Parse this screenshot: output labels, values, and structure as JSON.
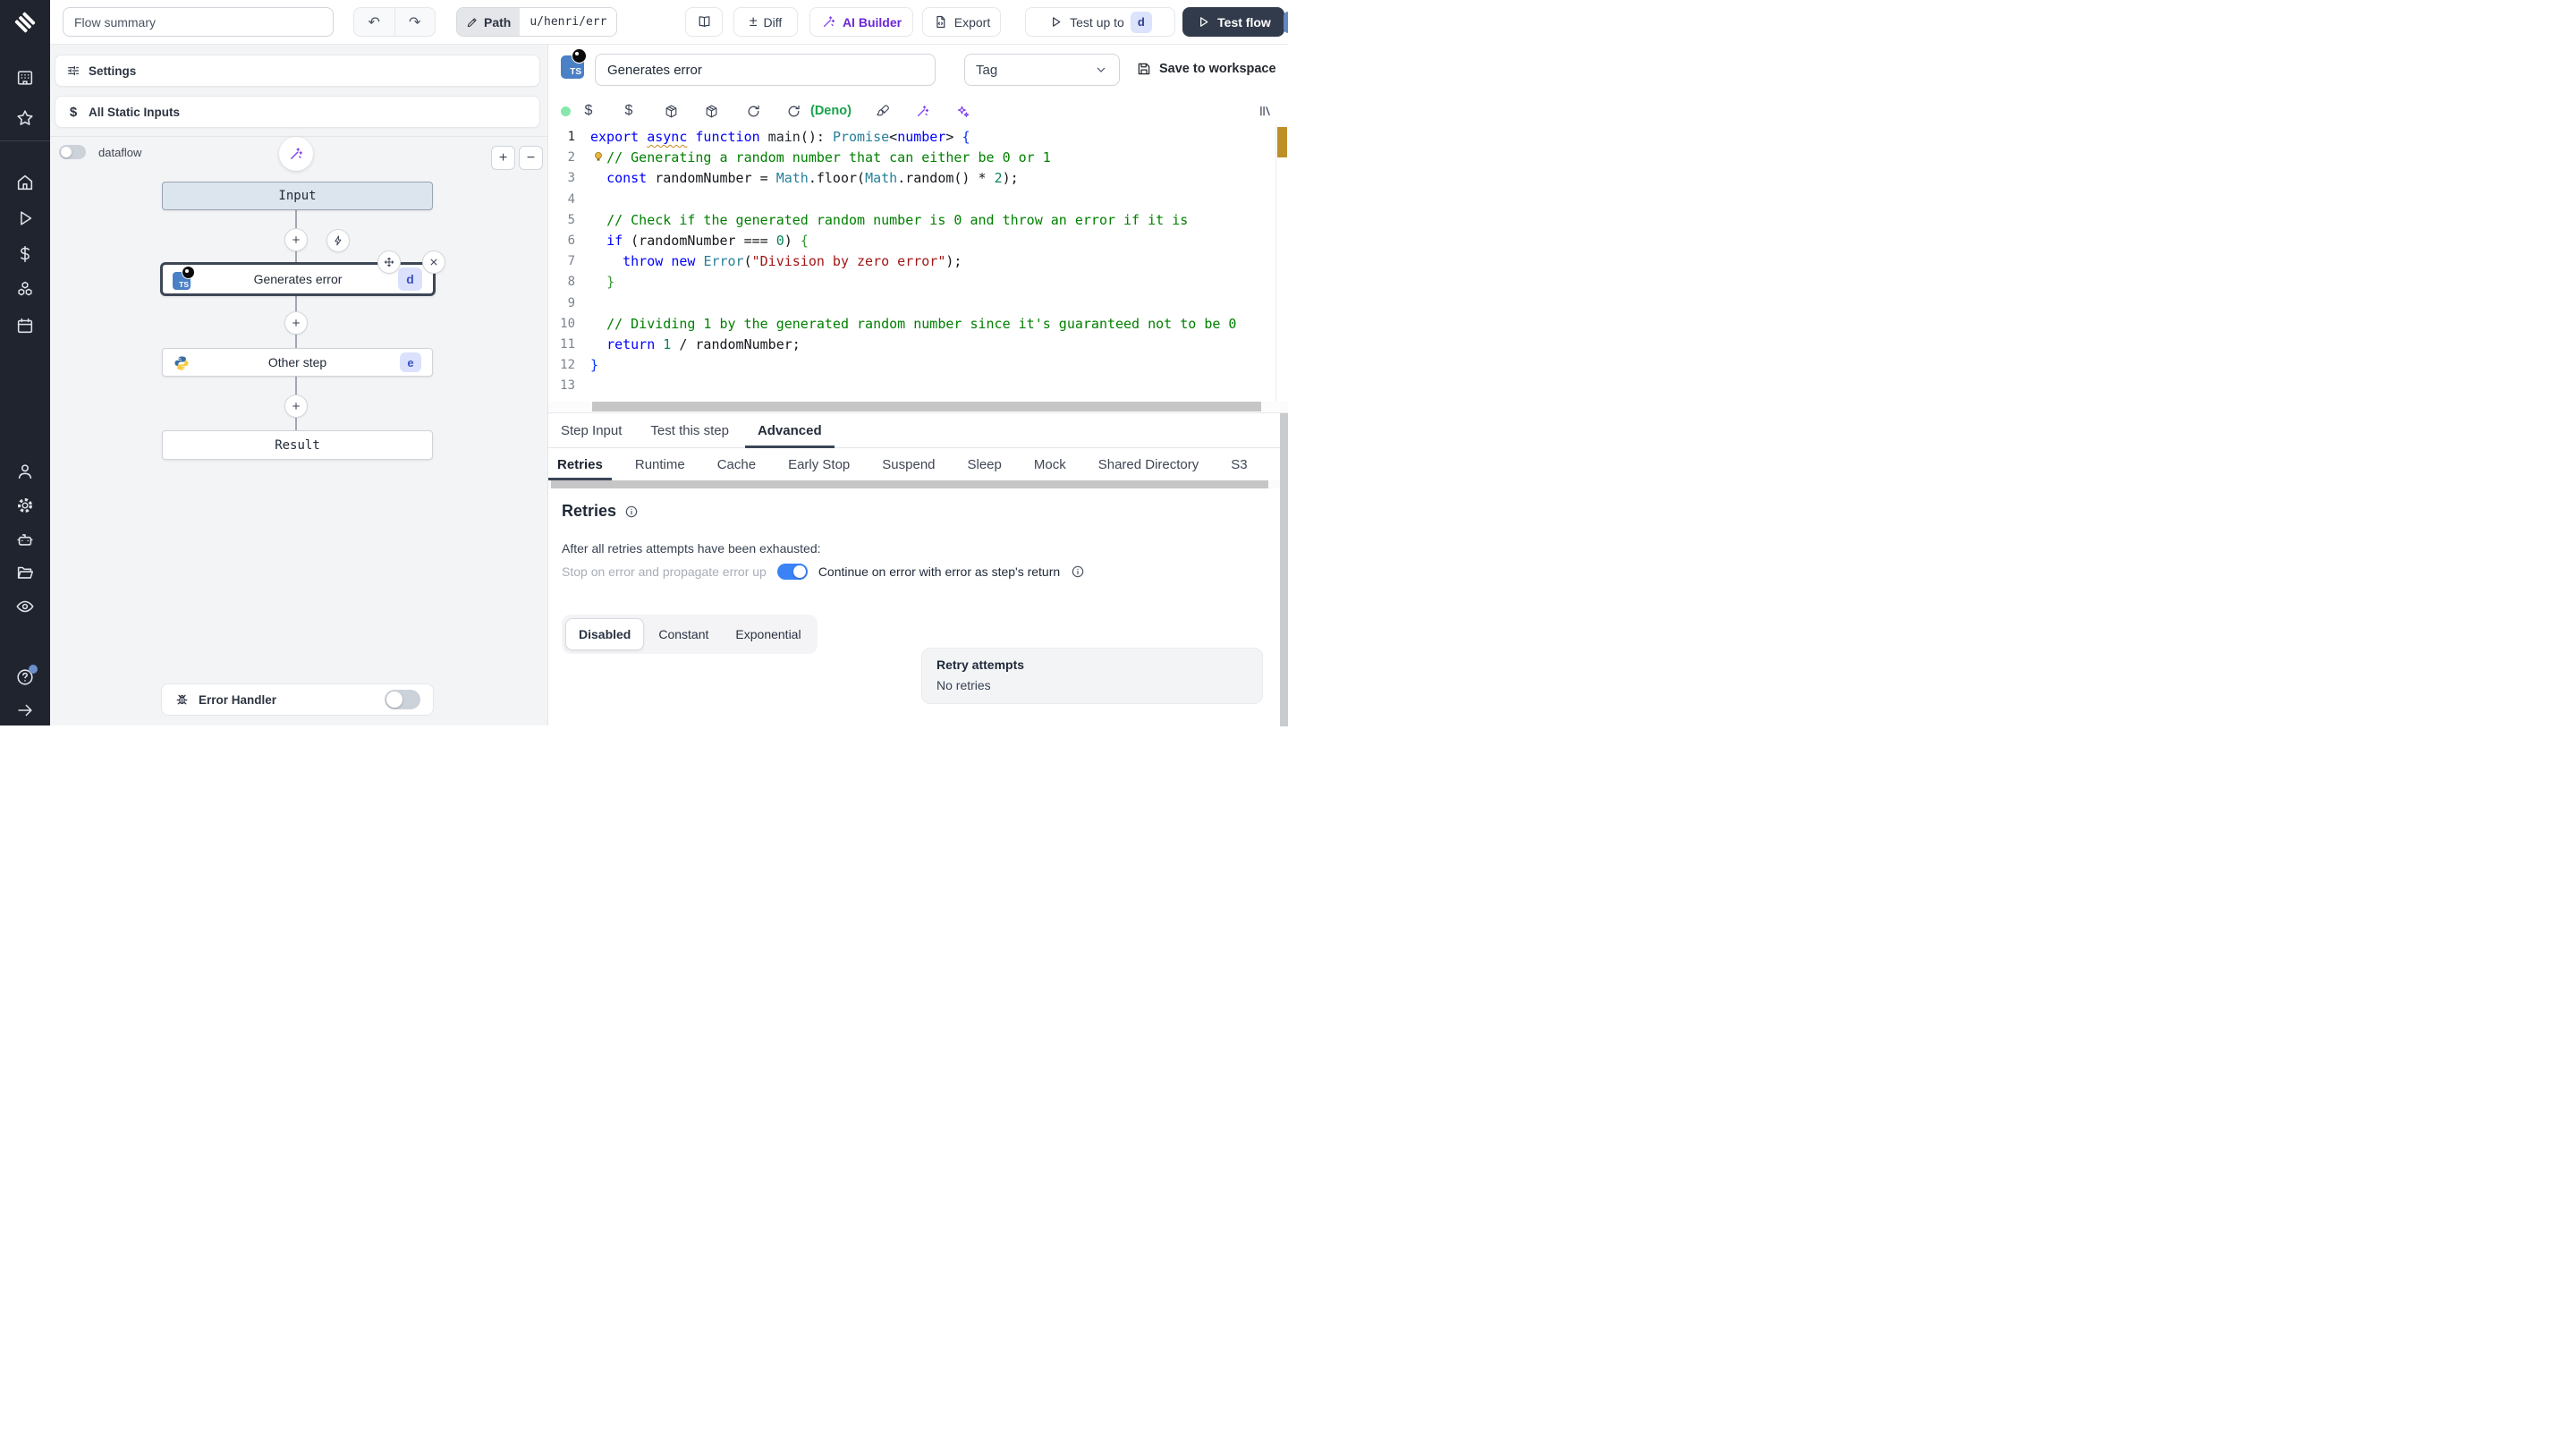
{
  "topbar": {
    "flow_summary_placeholder": "Flow summary",
    "undo": "↶",
    "redo": "↷",
    "path_label": "Path",
    "path_value": "u/henri/err",
    "diff_label": "Diff",
    "diff_icon": "±",
    "ai_builder_label": "AI Builder",
    "export_label": "Export",
    "test_up_to_label": "Test up to",
    "test_up_to_badge": "d",
    "test_flow_label": "Test flow"
  },
  "flow_panel": {
    "settings_label": "Settings",
    "static_inputs_icon": "$",
    "static_inputs_label": "All Static Inputs",
    "dataflow_label": "dataflow",
    "zoom_in_label": "+",
    "zoom_out_label": "−",
    "input_node_label": "Input",
    "step_node": {
      "label": "Generates error",
      "lang": "TS",
      "badge": "d"
    },
    "other_node": {
      "label": "Other step",
      "badge": "e"
    },
    "result_node_label": "Result",
    "error_handler_label": "Error Handler"
  },
  "editor": {
    "lang_badge": "TS",
    "step_name_value": "Generates error",
    "tag_placeholder": "Tag",
    "save_label": "Save to workspace",
    "dollar_icon": "$",
    "lang_label": "(Deno)",
    "lines": [
      {
        "n": 1,
        "seg": [
          [
            "kw",
            "export "
          ],
          [
            "kwu",
            "async"
          ],
          [
            "kw",
            " function"
          ],
          [
            "fn",
            " main"
          ],
          [
            "pl",
            "(): "
          ],
          [
            "ty",
            "Promise"
          ],
          [
            "pl",
            "<"
          ],
          [
            "kw",
            "number"
          ],
          [
            "pl",
            "> "
          ],
          [
            "brb",
            "{"
          ]
        ]
      },
      {
        "n": 2,
        "seg": [
          [
            "pl",
            "  "
          ],
          [
            "com",
            "// Generating a random number that can either be 0 or 1"
          ]
        ]
      },
      {
        "n": 3,
        "seg": [
          [
            "pl",
            "  "
          ],
          [
            "kw",
            "const"
          ],
          [
            "pl",
            " randomNumber = "
          ],
          [
            "ty",
            "Math"
          ],
          [
            "pl",
            ".floor("
          ],
          [
            "ty",
            "Math"
          ],
          [
            "pl",
            ".random() * "
          ],
          [
            "num",
            "2"
          ],
          [
            "pl",
            ");"
          ]
        ]
      },
      {
        "n": 4,
        "seg": []
      },
      {
        "n": 5,
        "seg": [
          [
            "pl",
            "  "
          ],
          [
            "com",
            "// Check if the generated random number is 0 and throw an error if it is"
          ]
        ]
      },
      {
        "n": 6,
        "seg": [
          [
            "pl",
            "  "
          ],
          [
            "kw",
            "if"
          ],
          [
            "pl",
            " (randomNumber === "
          ],
          [
            "num",
            "0"
          ],
          [
            "pl",
            ") "
          ],
          [
            "brg",
            "{"
          ]
        ]
      },
      {
        "n": 7,
        "seg": [
          [
            "pl",
            "    "
          ],
          [
            "kw",
            "throw"
          ],
          [
            "pl",
            " "
          ],
          [
            "kw",
            "new"
          ],
          [
            "pl",
            " "
          ],
          [
            "ty",
            "Error"
          ],
          [
            "pl",
            "("
          ],
          [
            "str",
            "\"Division by zero error\""
          ],
          [
            "pl",
            ");"
          ]
        ]
      },
      {
        "n": 8,
        "seg": [
          [
            "pl",
            "  "
          ],
          [
            "brg",
            "}"
          ]
        ]
      },
      {
        "n": 9,
        "seg": []
      },
      {
        "n": 10,
        "seg": [
          [
            "pl",
            "  "
          ],
          [
            "com",
            "// Dividing 1 by the generated random number since it's guaranteed not to be 0"
          ]
        ]
      },
      {
        "n": 11,
        "seg": [
          [
            "pl",
            "  "
          ],
          [
            "kw",
            "return"
          ],
          [
            "pl",
            " "
          ],
          [
            "num",
            "1"
          ],
          [
            "pl",
            " / randomNumber;"
          ]
        ]
      },
      {
        "n": 12,
        "seg": [
          [
            "brb",
            "}"
          ]
        ]
      },
      {
        "n": 13,
        "seg": []
      }
    ]
  },
  "bottom_panel": {
    "tabs": [
      "Step Input",
      "Test this step",
      "Advanced"
    ],
    "active_tab": "Advanced",
    "subtabs": [
      "Retries",
      "Runtime",
      "Cache",
      "Early Stop",
      "Suspend",
      "Sleep",
      "Mock",
      "Shared Directory",
      "S3"
    ],
    "active_subtab": "Retries",
    "retries": {
      "title": "Retries",
      "exhausted_label": "After all retries attempts have been exhausted:",
      "stop_label": "Stop on error and propagate error up",
      "continue_label": "Continue on error with error as step's return",
      "modes": [
        "Disabled",
        "Constant",
        "Exponential"
      ],
      "active_mode": "Disabled",
      "attempts_title": "Retry attempts",
      "attempts_value": "No retries"
    }
  },
  "colors": {
    "sidebar_bg": "#1f242e",
    "accent_purple": "#7c3aed",
    "deno_green": "#16a34a",
    "toggle_blue": "#3b82f6",
    "badge_bg": "#dbe1fc",
    "badge_text": "#3d52c5",
    "input_node_bg": "#dce4ed",
    "ruler_gold": "#bd9027",
    "status_green": "#86e8ab"
  }
}
